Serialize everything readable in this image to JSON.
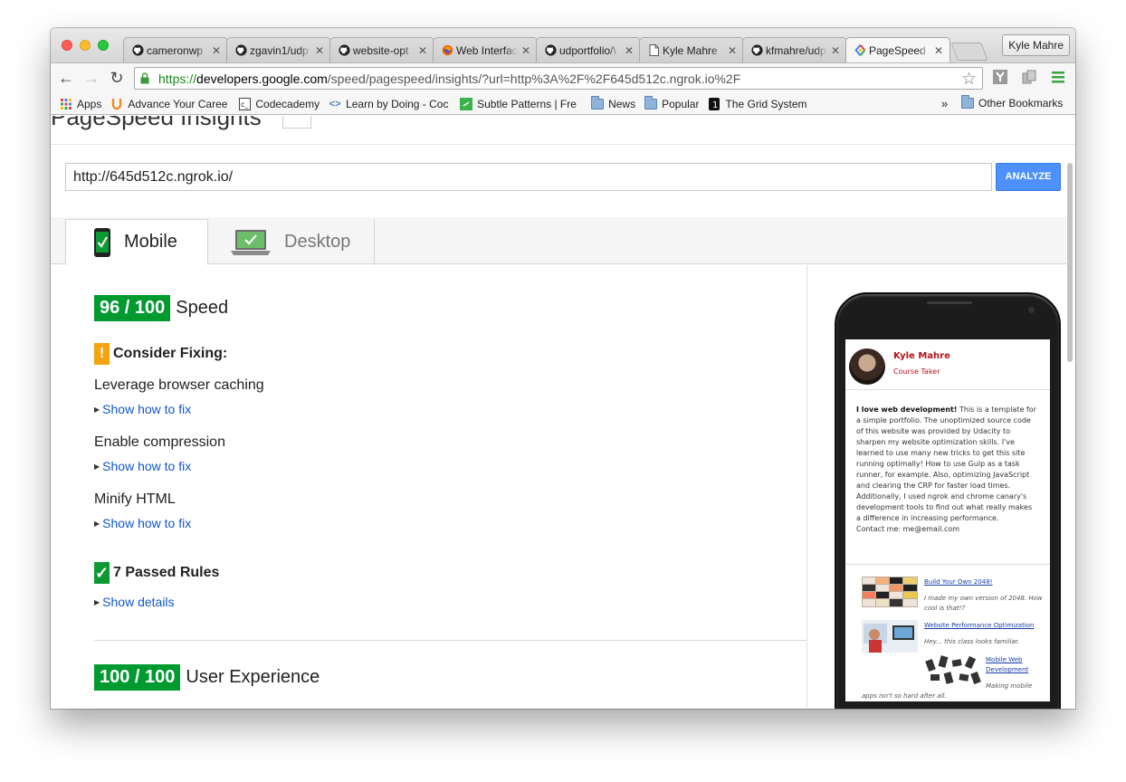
{
  "browser": {
    "tabs": [
      {
        "title": "cameronwp",
        "icon": "github-icon"
      },
      {
        "title": "zgavin1/udp",
        "icon": "github-icon"
      },
      {
        "title": "website-opt",
        "icon": "github-icon"
      },
      {
        "title": "Web Interfac",
        "icon": "firefox-icon"
      },
      {
        "title": "udportfolio/\\",
        "icon": "github-icon"
      },
      {
        "title": "Kyle Mahre",
        "icon": "page-icon"
      },
      {
        "title": "kfmahre/udp",
        "icon": "github-icon"
      },
      {
        "title": "PageSpeed",
        "icon": "pagespeed-icon"
      }
    ],
    "profile_name": "Kyle Mahre",
    "url_scheme": "https://",
    "url_host": "developers.google.com",
    "url_rest": "/speed/pagespeed/insights/?url=http%3A%2F%2F645d512c.ngrok.io%2F",
    "bookmarks": [
      {
        "label": "Apps",
        "icon": "apps-grid-icon"
      },
      {
        "label": "Advance Your Caree",
        "icon": "udacity-icon"
      },
      {
        "label": "Codecademy",
        "icon": "codecademy-icon"
      },
      {
        "label": "Learn by Doing - Coc",
        "icon": "code-icon"
      },
      {
        "label": "Subtle Patterns | Fre",
        "icon": "subtle-patterns-icon"
      },
      {
        "label": "News",
        "icon": "folder-icon"
      },
      {
        "label": "Popular",
        "icon": "folder-icon"
      },
      {
        "label": "The Grid System",
        "icon": "grid-system-icon"
      }
    ],
    "bookmarks_overflow": "»",
    "other_bookmarks": "Other Bookmarks"
  },
  "page": {
    "header_title": "PageSpeed Insights",
    "url_value": "http://645d512c.ngrok.io/",
    "analyze_label": "ANALYZE",
    "tab_mobile": "Mobile",
    "tab_desktop": "Desktop",
    "speed_score": "96 / 100",
    "speed_label": "Speed",
    "consider_fixing": "Consider Fixing:",
    "rules": [
      {
        "title": "Leverage browser caching",
        "link": "Show how to fix"
      },
      {
        "title": "Enable compression",
        "link": "Show how to fix"
      },
      {
        "title": "Minify HTML",
        "link": "Show how to fix"
      }
    ],
    "passed_rules": "7 Passed Rules",
    "show_details": "Show details",
    "ux_score": "100 / 100",
    "ux_label": "User Experience"
  },
  "preview": {
    "name": "Kyle Mahre",
    "role": "Course Taker",
    "bio_bold": "I love web development!",
    "bio_text": " This is a template for a simple portfolio. The unoptimized source code of this website was provided by Udacity to sharpen my website optimization skills. I've learned to use many new tricks to get this site running optimally! How to use Gulp as a task runner, for example. Also, optimizing JavaScript and clearing the CRP for faster load times. Additionally, I used ngrok and chrome canary's development tools to find out what really makes a difference in increasing performance.",
    "contact": "Contact me: me@email.com",
    "projects": [
      {
        "title": "Build Your Own 2048!",
        "desc": "I made my own version of 2048. How cool is that!?"
      },
      {
        "title": "Website Performance Optimization",
        "desc": "Hey... this class looks familiar."
      },
      {
        "title": "Mobile Web Development",
        "desc": "Making mobile apps isn't so hard after all."
      }
    ]
  },
  "colors": {
    "score_green": "#009a2f",
    "warning_orange": "#f5a30e",
    "link_blue": "#1155cc",
    "analyze_blue": "#4d90fe",
    "preview_red": "#b3141b"
  }
}
